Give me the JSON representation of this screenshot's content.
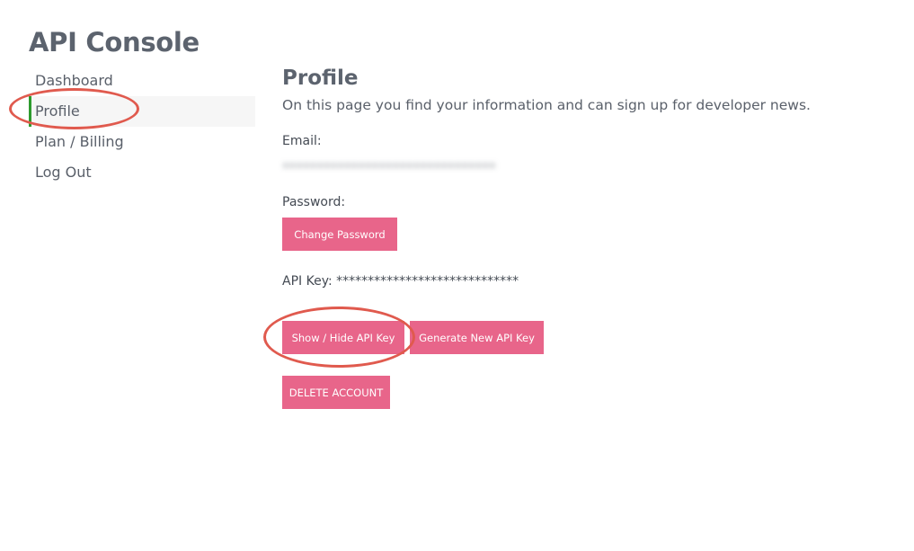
{
  "app": {
    "title": "API Console"
  },
  "sidebar": {
    "items": [
      {
        "label": "Dashboard",
        "active": false
      },
      {
        "label": "Profile",
        "active": true
      },
      {
        "label": "Plan / Billing",
        "active": false
      },
      {
        "label": "Log Out",
        "active": false
      }
    ]
  },
  "main": {
    "title": "Profile",
    "description": "On this page you find your information and can sign up for developer news.",
    "email_label": "Email:",
    "email_value": "•••••••••••••••••••••••••••••••",
    "password_label": "Password:",
    "change_password_label": "Change Password",
    "api_key_label": "API Key:",
    "api_key_value": "*****************************",
    "show_hide_label": "Show / Hide API Key",
    "generate_label": "Generate New API Key",
    "delete_label": "DELETE ACCOUNT"
  },
  "colors": {
    "button": "#e8658a",
    "active_indicator": "#2e9b2e",
    "annotation": "#e05a4e"
  }
}
